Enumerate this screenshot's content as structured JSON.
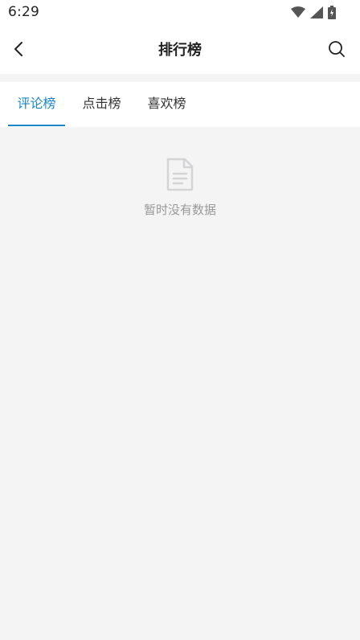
{
  "status_bar": {
    "time": "6:29",
    "icons": [
      "wifi-icon",
      "signal-icon",
      "battery-icon"
    ]
  },
  "header": {
    "title": "排行榜",
    "back_icon": "chevron-left-icon",
    "search_icon": "search-icon"
  },
  "tabs": [
    {
      "label": "评论榜",
      "active": true
    },
    {
      "label": "点击榜",
      "active": false
    },
    {
      "label": "喜欢榜",
      "active": false
    }
  ],
  "empty_state": {
    "icon": "document-icon",
    "text": "暂时没有数据"
  },
  "colors": {
    "accent": "#1a86c8",
    "background": "#f4f4f5",
    "muted_text": "#999999"
  }
}
